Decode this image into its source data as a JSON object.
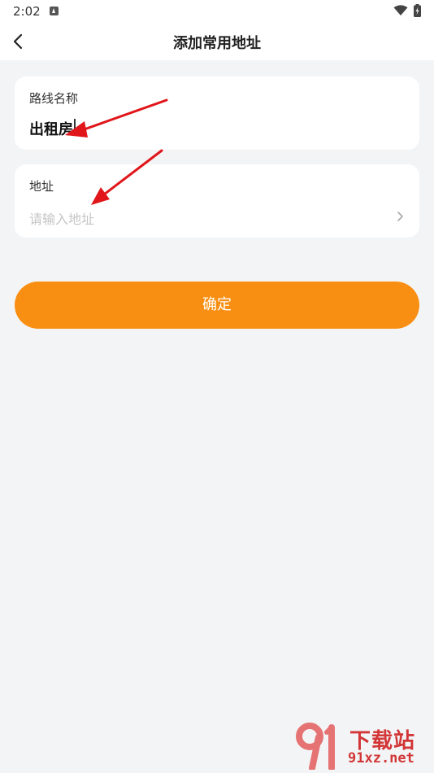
{
  "status_bar": {
    "time": "2:02"
  },
  "nav": {
    "title": "添加常用地址",
    "back_icon": "chevron-left-icon"
  },
  "form": {
    "route_name": {
      "label": "路线名称",
      "value": "出租房"
    },
    "address": {
      "label": "地址",
      "value": "",
      "placeholder": "请输入地址"
    }
  },
  "confirm_label": "确定",
  "watermark": {
    "title": "下载站",
    "url": "91xz.net"
  },
  "colors": {
    "accent": "#f98f12",
    "background": "#f3f4f6",
    "annotation_arrow": "#e0161a"
  }
}
